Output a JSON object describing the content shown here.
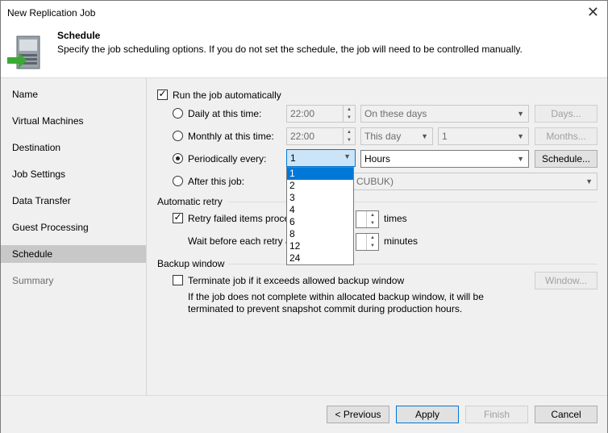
{
  "window": {
    "title": "New Replication Job",
    "close_glyph": "✕"
  },
  "header": {
    "title": "Schedule",
    "description": "Specify the job scheduling options. If you do not set the schedule, the job will need to be controlled manually.",
    "icon": "replication-job-icon"
  },
  "sidebar": {
    "items": [
      {
        "label": "Name"
      },
      {
        "label": "Virtual Machines"
      },
      {
        "label": "Destination"
      },
      {
        "label": "Job Settings"
      },
      {
        "label": "Data Transfer"
      },
      {
        "label": "Guest Processing"
      },
      {
        "label": "Schedule"
      },
      {
        "label": "Summary"
      }
    ]
  },
  "schedule": {
    "run_auto_label": "Run the job automatically",
    "daily": {
      "label": "Daily at this time:",
      "time": "22:00",
      "days_option": "On these days",
      "button": "Days..."
    },
    "monthly": {
      "label": "Monthly at this time:",
      "time": "22:00",
      "day_option": "This day",
      "day_value": "1",
      "button": "Months..."
    },
    "periodic": {
      "label": "Periodically every:",
      "value": "1",
      "unit": "Hours",
      "button": "Schedule..."
    },
    "after": {
      "label": "After this job:",
      "partial_value": "CUBUK)"
    },
    "dropdown_options": [
      "1",
      "2",
      "3",
      "4",
      "6",
      "8",
      "12",
      "24"
    ]
  },
  "retry": {
    "section": "Automatic retry",
    "retry_label_partial": "Retry failed items proce",
    "times_unit": "times",
    "wait_label_partial": "Wait before each retry a",
    "minutes_unit": "minutes"
  },
  "backup_window": {
    "section": "Backup window",
    "terminate_label": "Terminate job if it exceeds allowed backup window",
    "note_line1": "If the job does not complete within allocated backup window, it will be",
    "note_line2": "terminated to prevent snapshot commit during production hours.",
    "button": "Window..."
  },
  "footer": {
    "previous": "< Previous",
    "apply": "Apply",
    "finish": "Finish",
    "cancel": "Cancel"
  },
  "colors": {
    "accent": "#0078d7",
    "selected_sidebar": "#c8c8c8",
    "icon_green": "#3aaa35"
  }
}
